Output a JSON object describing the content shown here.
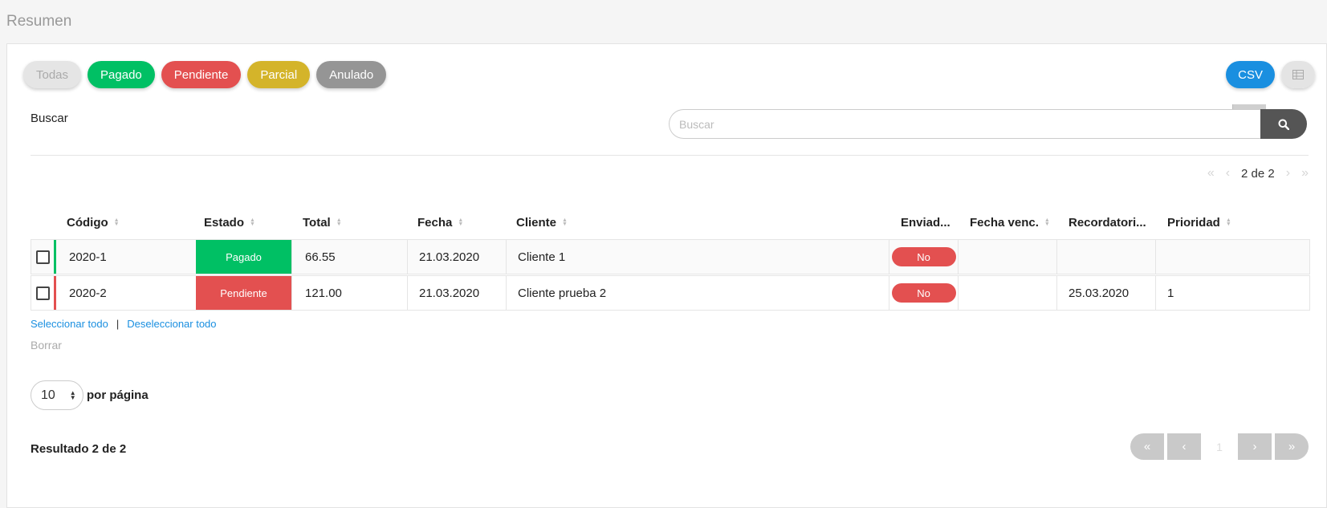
{
  "page": {
    "title": "Resumen"
  },
  "filters": [
    {
      "label": "Todas"
    },
    {
      "label": "Pagado"
    },
    {
      "label": "Pendiente"
    },
    {
      "label": "Parcial"
    },
    {
      "label": "Anulado"
    }
  ],
  "toolbar": {
    "csv_label": "CSV",
    "table_view_icon": "table-icon",
    "card_view_icon": "square-icon"
  },
  "search": {
    "label": "Buscar",
    "placeholder": "Buscar"
  },
  "top_pager": {
    "text": "2 de 2"
  },
  "table": {
    "columns": [
      "Código",
      "Estado",
      "Total",
      "Fecha",
      "Cliente",
      "Enviad...",
      "Fecha venc.",
      "Recordatori...",
      "Prioridad"
    ],
    "rows": [
      {
        "codigo": "2020-1",
        "estado": "Pagado",
        "total": "66.55",
        "fecha": "21.03.2020",
        "cliente": "Cliente 1",
        "enviado": "No",
        "fecha_venc": "",
        "recordatorio": "",
        "prioridad": ""
      },
      {
        "codigo": "2020-2",
        "estado": "Pendiente",
        "total": "121.00",
        "fecha": "21.03.2020",
        "cliente": "Cliente prueba 2",
        "enviado": "No",
        "fecha_venc": "",
        "recordatorio": "25.03.2020",
        "prioridad": "1"
      }
    ]
  },
  "selection": {
    "select_all": "Seleccionar todo",
    "separator": "|",
    "deselect_all": "Deseleccionar todo",
    "delete": "Borrar"
  },
  "per_page": {
    "value": "10",
    "label": "por página"
  },
  "result": {
    "text": "Resultado 2 de 2"
  },
  "bottom_pager": {
    "current_page": "1"
  },
  "colors": {
    "pagado": "#00c064",
    "pendiente": "#e35050",
    "parcial": "#d4b42a",
    "anulado": "#959595",
    "accent": "#1a8fe0"
  }
}
